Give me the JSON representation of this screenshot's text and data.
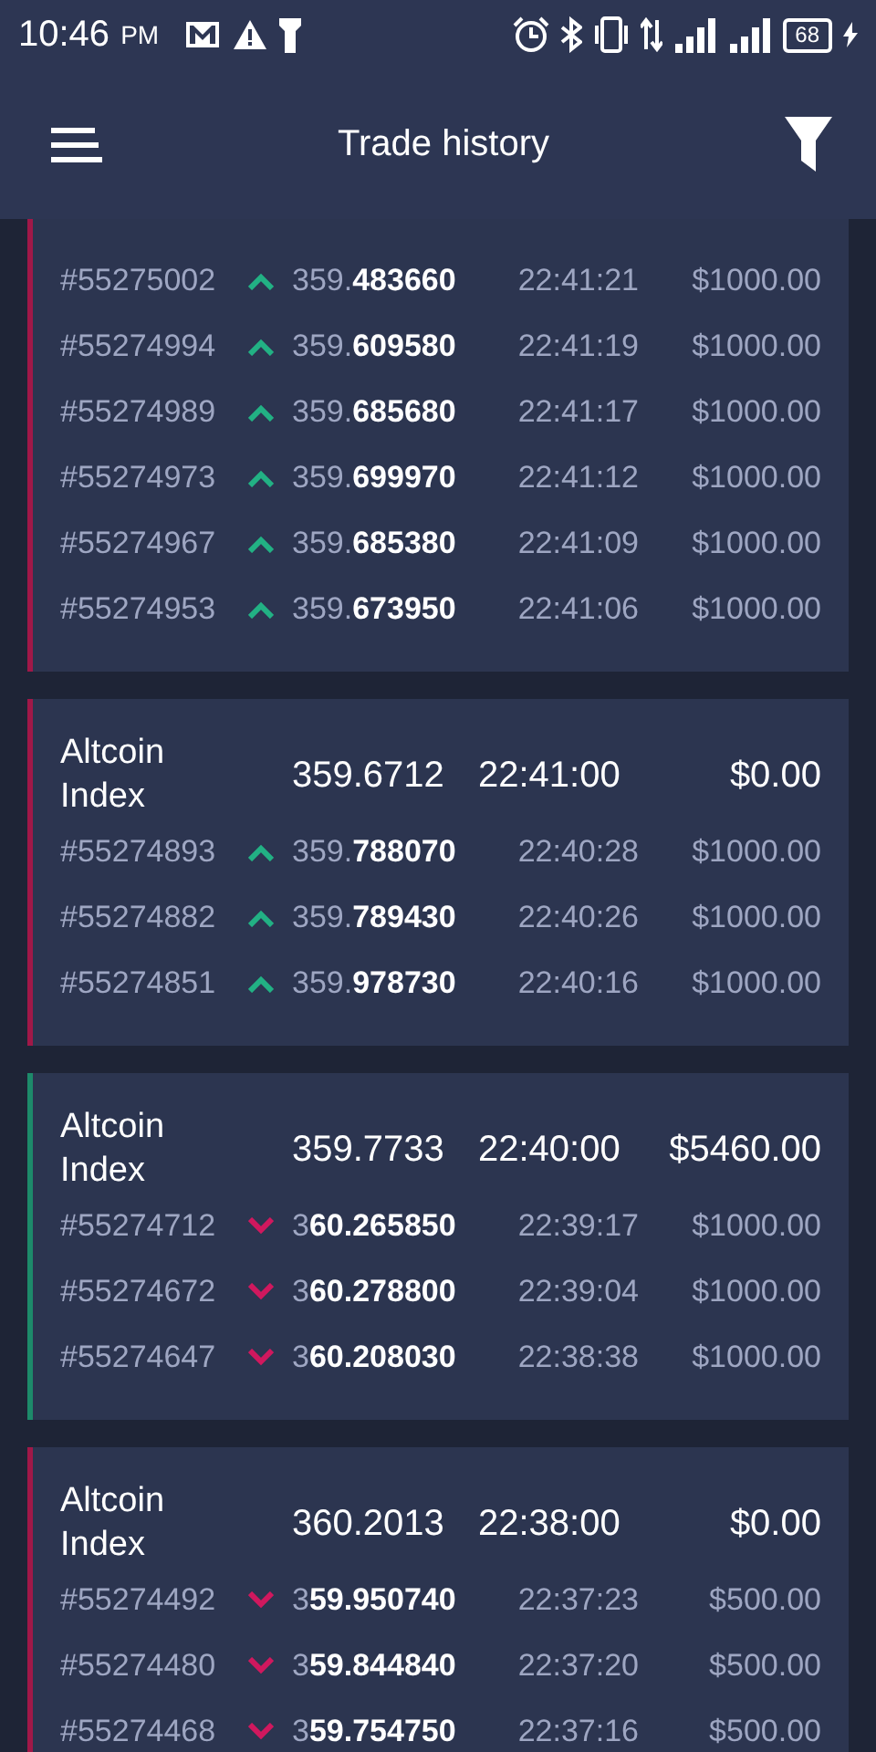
{
  "status_bar": {
    "time": "10:46",
    "ampm": "PM",
    "battery": "68"
  },
  "header": {
    "title": "Trade history"
  },
  "cards": [
    {
      "color": "#a01848",
      "trades": [
        {
          "id": "#55275002",
          "kind": "up",
          "price": "359.**483660**",
          "time": "22:41:21",
          "amount": "$1000.00"
        },
        {
          "id": "#55274994",
          "kind": "up",
          "price": "359.**609580**",
          "time": "22:41:19",
          "amount": "$1000.00"
        },
        {
          "id": "#55274989",
          "kind": "up",
          "price": "359.**685680**",
          "time": "22:41:17",
          "amount": "$1000.00"
        },
        {
          "id": "#55274973",
          "kind": "up",
          "price": "359.**699970**",
          "time": "22:41:12",
          "amount": "$1000.00"
        },
        {
          "id": "#55274967",
          "kind": "up",
          "price": "359.**685380**",
          "time": "22:41:09",
          "amount": "$1000.00"
        },
        {
          "id": "#55274953",
          "kind": "up",
          "price": "359.**673950**",
          "time": "22:41:06",
          "amount": "$1000.00"
        }
      ]
    },
    {
      "color": "#a01848",
      "summary": {
        "name": "Altcoin Index",
        "price": "359.6712",
        "time": "22:41:00",
        "total": "$0.00"
      },
      "trades": [
        {
          "id": "#55274893",
          "kind": "up",
          "price": "359.**788070**",
          "time": "22:40:28",
          "amount": "$1000.00"
        },
        {
          "id": "#55274882",
          "kind": "up",
          "price": "359.**789430**",
          "time": "22:40:26",
          "amount": "$1000.00"
        },
        {
          "id": "#55274851",
          "kind": "up",
          "price": "359.**978730**",
          "time": "22:40:16",
          "amount": "$1000.00"
        }
      ]
    },
    {
      "color": "#1d8a6a",
      "summary": {
        "name": "Altcoin Index",
        "price": "359.7733",
        "time": "22:40:00",
        "total": "$5460.00"
      },
      "trades": [
        {
          "id": "#55274712",
          "kind": "down",
          "price": "3**60.265850**",
          "time": "22:39:17",
          "amount": "$1000.00"
        },
        {
          "id": "#55274672",
          "kind": "down",
          "price": "3**60.278800**",
          "time": "22:39:04",
          "amount": "$1000.00"
        },
        {
          "id": "#55274647",
          "kind": "down",
          "price": "3**60.208030**",
          "time": "22:38:38",
          "amount": "$1000.00"
        }
      ]
    },
    {
      "color": "#a01848",
      "summary": {
        "name": "Altcoin Index",
        "price": "360.2013",
        "time": "22:38:00",
        "total": "$0.00"
      },
      "trades": [
        {
          "id": "#55274492",
          "kind": "down",
          "price": "3**59.950740**",
          "time": "22:37:23",
          "amount": "$500.00"
        },
        {
          "id": "#55274480",
          "kind": "down",
          "price": "3**59.844840**",
          "time": "22:37:20",
          "amount": "$500.00"
        },
        {
          "id": "#55274468",
          "kind": "down",
          "price": "3**59.754750**",
          "time": "22:37:16",
          "amount": "$500.00"
        }
      ]
    }
  ]
}
